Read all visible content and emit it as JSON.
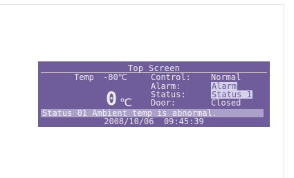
{
  "screen": {
    "title": "Top Screen",
    "temp_label": "Temp",
    "temp_setpoint": "-80℃",
    "temp_value": "0",
    "temp_unit": "℃",
    "control_label": "Control:",
    "control_value": "Normal",
    "alarm_label": "Alarm:",
    "alarm_value": "Alarm",
    "status_label": "Status:",
    "status_value": "Status 1",
    "door_label": "Door:",
    "door_value": "Closed",
    "message": "Status 01 Ambient temp is abnormal.",
    "date": "2008/10/06",
    "time": "09:45:39"
  },
  "colors": {
    "lcd_background": "#6e5d9a",
    "lcd_text": "#ecebf6",
    "highlight": "#d6d1ea",
    "message_bar": "#aaa0c8"
  }
}
